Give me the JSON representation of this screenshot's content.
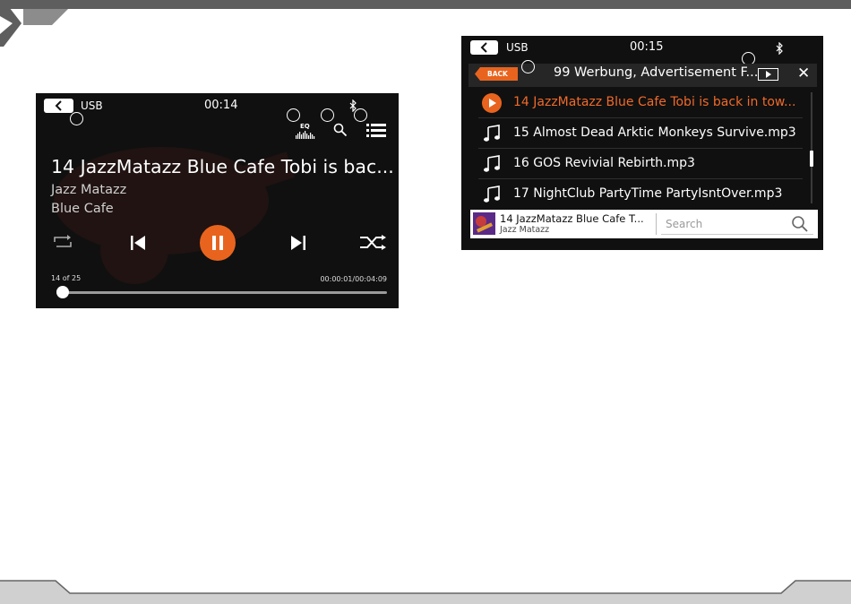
{
  "left_screen": {
    "source": "USB",
    "clock": "00:14",
    "eq_label": "EQ",
    "track_title": "14 JazzMatazz Blue Cafe Tobi is bac...",
    "artist": "Jazz Matazz",
    "album": "Blue Cafe",
    "track_count": "14 of 25",
    "time": "00:00:01/00:04:09",
    "progress_fraction": 0.01
  },
  "right_screen": {
    "source": "USB",
    "clock": "00:15",
    "back_label": "BACK",
    "folder_title": "99 Werbung, Advertisement F...",
    "tracks": [
      {
        "label": "14 JazzMatazz Blue Cafe Tobi is back in tow...",
        "state": "playing"
      },
      {
        "label": "15 Almost Dead Arktic Monkeys Survive.mp3",
        "state": "normal"
      },
      {
        "label": "16 GOS Revivial Rebirth.mp3",
        "state": "normal"
      },
      {
        "label": "17 NightClub PartyTime PartyIsntOver.mp3",
        "state": "normal"
      }
    ],
    "now_playing_title": "14 JazzMatazz Blue Cafe T...",
    "now_playing_artist": "Jazz Matazz",
    "search_placeholder": "Search"
  },
  "colors": {
    "accent": "#e8641e",
    "screen_bg": "#101010",
    "frame_gray": "#5e5e5e"
  }
}
